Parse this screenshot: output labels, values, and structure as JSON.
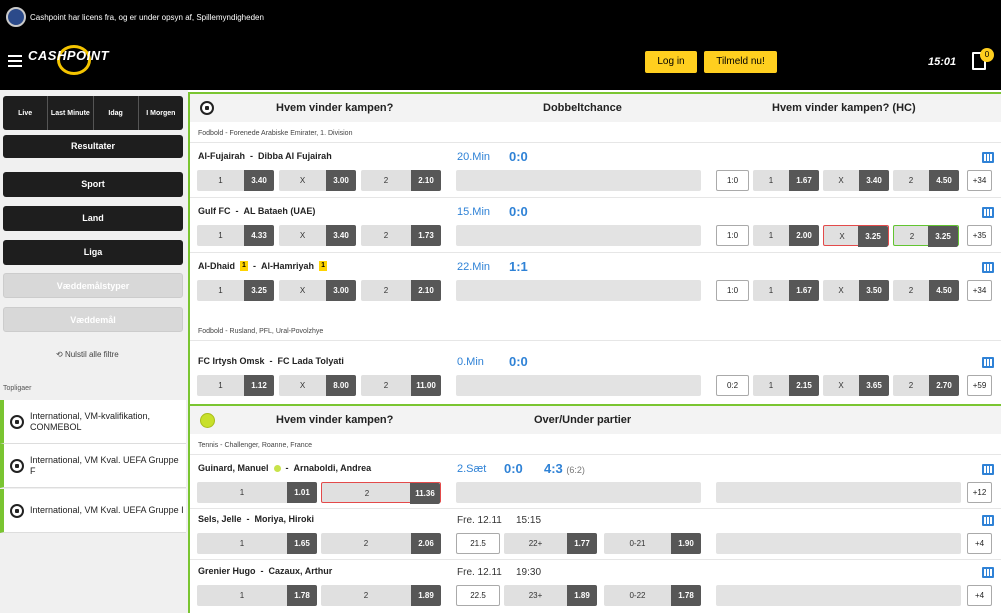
{
  "topbar": {
    "license": "Cashpoint har licens fra, og er under opsyn af, Spillemyndigheden"
  },
  "header": {
    "logo": "CASHPOINT",
    "login": "Log in",
    "signup": "Tilmeld nu!",
    "clock": "15:01",
    "coupon_count": "0"
  },
  "sidebar": {
    "tabs": [
      "Live",
      "Last Minute",
      "Idag",
      "I Morgen"
    ],
    "results": "Resultater",
    "filters": [
      "Sport",
      "Land",
      "Liga",
      "Væddemålstyper",
      "Væddemål"
    ],
    "reset": "Nulstil alle filtre",
    "top_leagues_label": "Topligaer",
    "top_leagues": [
      "International, VM-kvalifikation, CONMEBOL",
      "International, VM Kval. UEFA Gruppe F",
      "International, VM Kval. UEFA Gruppe I"
    ]
  },
  "football": {
    "headers": [
      "Hvem vinder kampen?",
      "Dobbeltchance",
      "Hvem vinder kampen? (HC)"
    ],
    "league1": "Fodbold - Forenede Arabiske Emirater, 1. Division",
    "league2": "Fodbold - Rusland, PFL, Ural-Povolzhye",
    "matches": [
      {
        "home": "Al-Fujairah",
        "away": "Dibba Al Fujairah",
        "time": "20.Min",
        "score": "0:0",
        "o1": "3.40",
        "ox": "3.00",
        "o2": "2.10",
        "hc": "1:0",
        "h1": "1.67",
        "hx": "3.40",
        "h2": "4.50",
        "more": "+34"
      },
      {
        "home": "Gulf FC",
        "away": "AL Bataeh (UAE)",
        "time": "15.Min",
        "score": "0:0",
        "o1": "4.33",
        "ox": "3.40",
        "o2": "1.73",
        "hc": "1:0",
        "h1": "2.00",
        "hx": "3.25",
        "h2": "3.25",
        "more": "+35"
      },
      {
        "home": "Al-Dhaid",
        "home_card": "1",
        "away": "Al-Hamriyah",
        "away_card": "1",
        "time": "22.Min",
        "score": "1:1",
        "o1": "3.25",
        "ox": "3.00",
        "o2": "2.10",
        "hc": "1:0",
        "h1": "1.67",
        "hx": "3.50",
        "h2": "4.50",
        "more": "+34"
      },
      {
        "home": "FC Irtysh Omsk",
        "away": "FC Lada Tolyati",
        "time": "0.Min",
        "score": "0:0",
        "o1": "1.12",
        "ox": "8.00",
        "o2": "11.00",
        "hc": "0:2",
        "h1": "2.15",
        "hx": "3.65",
        "h2": "2.70",
        "more": "+59"
      }
    ],
    "labels": {
      "one": "1",
      "x": "X",
      "two": "2"
    }
  },
  "tennis": {
    "headers": [
      "Hvem vinder kampen?",
      "Over/Under partier"
    ],
    "league": "Tennis - Challenger, Roanne, France",
    "matches": [
      {
        "home": "Guinard, Manuel",
        "away": "Arnaboldi, Andrea",
        "set": "2.Sæt",
        "setscore": "0:0",
        "games": "4:3",
        "sub": "(6:2)",
        "o1": "1.01",
        "o2": "11.36",
        "more": "+12"
      },
      {
        "home": "Sels, Jelle",
        "away": "Moriya, Hiroki",
        "date": "Fre. 12.11",
        "time": "15:15",
        "o1": "1.65",
        "o2": "2.06",
        "line": "21.5",
        "over": "22+",
        "ov": "1.77",
        "under": "0-21",
        "uv": "1.90",
        "more": "+4"
      },
      {
        "home": "Grenier Hugo",
        "away": "Cazaux, Arthur",
        "date": "Fre. 12.11",
        "time": "19:30",
        "o1": "1.78",
        "o2": "1.89",
        "line": "22.5",
        "over": "23+",
        "ov": "1.89",
        "under": "0-22",
        "uv": "1.78",
        "more": "+4"
      }
    ]
  }
}
